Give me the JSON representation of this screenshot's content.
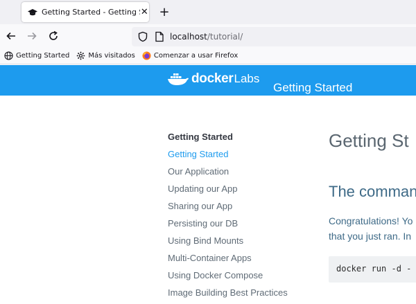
{
  "browser": {
    "tab": {
      "title": "Getting Started - Getting Started",
      "icon": "graduation-cap-icon",
      "close": "✕"
    },
    "new_tab": "+",
    "url": {
      "host": "localhost",
      "path": "/tutorial/"
    },
    "bookmarks": [
      {
        "label": "Getting Started",
        "icon": "globe-icon"
      },
      {
        "label": "Más visitados",
        "icon": "gear-icon"
      },
      {
        "label": "Comenzar a usar Firefox",
        "icon": "firefox-icon"
      }
    ]
  },
  "header": {
    "logo_docker": "docker",
    "logo_labs": "Labs",
    "title": "Getting Started",
    "color": "#1d9bee"
  },
  "sidebar": {
    "heading": "Getting Started",
    "items": [
      {
        "label": "Getting Started",
        "active": true
      },
      {
        "label": "Our Application"
      },
      {
        "label": "Updating our App"
      },
      {
        "label": "Sharing our App"
      },
      {
        "label": "Persisting our DB"
      },
      {
        "label": "Using Bind Mounts"
      },
      {
        "label": "Multi-Container Apps"
      },
      {
        "label": "Using Docker Compose"
      },
      {
        "label": "Image Building Best Practices"
      }
    ]
  },
  "main": {
    "h1": "Getting St",
    "h2": "The comman",
    "para_line1": "Congratulations! Yo",
    "para_line2": "that you just ran. In",
    "code": "docker run -d -"
  }
}
